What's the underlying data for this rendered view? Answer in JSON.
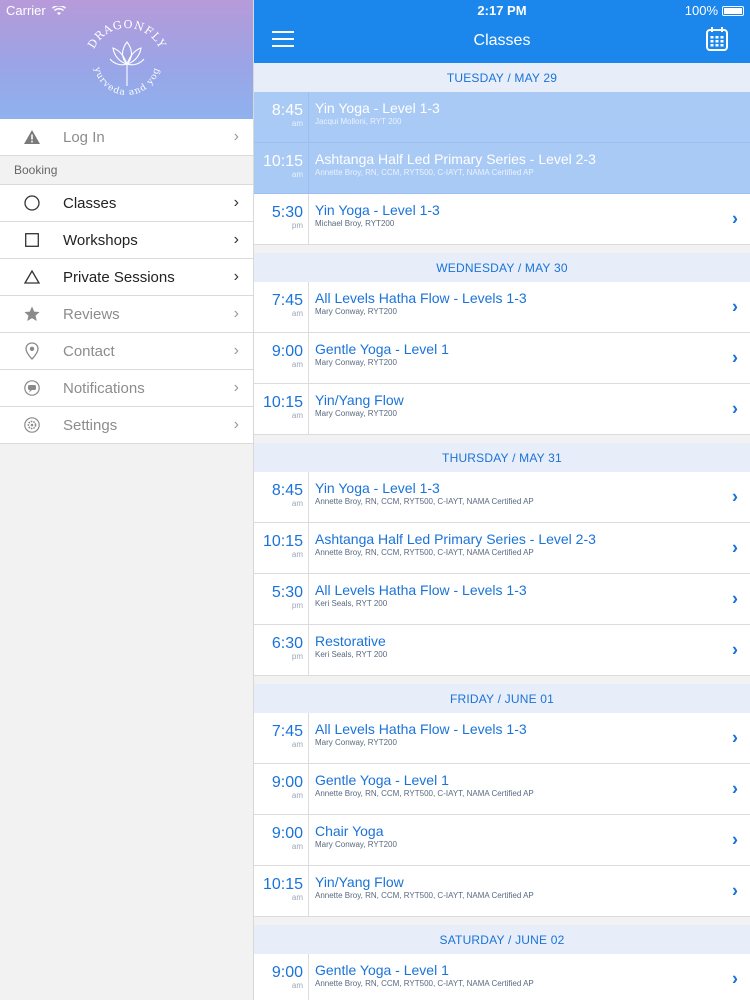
{
  "status": {
    "carrier": "Carrier",
    "time": "2:17 PM",
    "battery": "100%"
  },
  "sidebar": {
    "brand": "DRAGONFLY",
    "brand_tagline": "ayurveda and yoga",
    "login": {
      "label": "Log In",
      "icon": "warning-triangle-icon"
    },
    "section": "Booking",
    "items": [
      {
        "label": "Classes",
        "icon": "circle-icon"
      },
      {
        "label": "Workshops",
        "icon": "square-icon"
      },
      {
        "label": "Private Sessions",
        "icon": "triangle-icon"
      },
      {
        "label": "Reviews",
        "icon": "star-icon"
      },
      {
        "label": "Contact",
        "icon": "location-pin-icon"
      },
      {
        "label": "Notifications",
        "icon": "chat-bubble-icon"
      },
      {
        "label": "Settings",
        "icon": "gear-icon"
      }
    ]
  },
  "header": {
    "title": "Classes"
  },
  "colors": {
    "accent": "#1b86ec",
    "highlight": "#a9caf5",
    "day_header_bg": "#e7eef9"
  },
  "days": [
    {
      "header": "TUESDAY / MAY 29",
      "classes": [
        {
          "time": "8:45",
          "ampm": "am",
          "name": "Yin Yoga - Level 1-3",
          "instructor": "Jacqui Molloni, RYT 200",
          "highlight": true
        },
        {
          "time": "10:15",
          "ampm": "am",
          "name": "Ashtanga Half Led Primary Series - Level 2-3",
          "instructor": "Annette Broy, RN, CCM, RYT500, C-IAYT, NAMA Certified AP",
          "highlight": true
        },
        {
          "time": "5:30",
          "ampm": "pm",
          "name": "Yin Yoga - Level 1-3",
          "instructor": "Michael Broy, RYT200",
          "highlight": false
        }
      ]
    },
    {
      "header": "WEDNESDAY / MAY 30",
      "classes": [
        {
          "time": "7:45",
          "ampm": "am",
          "name": "All Levels Hatha Flow - Levels 1-3",
          "instructor": "Mary Conway, RYT200",
          "highlight": false
        },
        {
          "time": "9:00",
          "ampm": "am",
          "name": "Gentle Yoga - Level 1",
          "instructor": "Mary Conway, RYT200",
          "highlight": false
        },
        {
          "time": "10:15",
          "ampm": "am",
          "name": "Yin/Yang Flow",
          "instructor": "Mary Conway, RYT200",
          "highlight": false
        }
      ]
    },
    {
      "header": "THURSDAY / MAY 31",
      "classes": [
        {
          "time": "8:45",
          "ampm": "am",
          "name": "Yin Yoga - Level 1-3",
          "instructor": "Annette Broy, RN, CCM, RYT500, C-IAYT, NAMA Certified AP",
          "highlight": false
        },
        {
          "time": "10:15",
          "ampm": "am",
          "name": "Ashtanga Half Led Primary Series - Level 2-3",
          "instructor": "Annette Broy, RN, CCM, RYT500, C-IAYT, NAMA Certified AP",
          "highlight": false
        },
        {
          "time": "5:30",
          "ampm": "pm",
          "name": "All Levels Hatha Flow - Levels 1-3",
          "instructor": "Keri Seals, RYT 200",
          "highlight": false
        },
        {
          "time": "6:30",
          "ampm": "pm",
          "name": "Restorative",
          "instructor": "Keri Seals, RYT 200",
          "highlight": false
        }
      ]
    },
    {
      "header": "FRIDAY / JUNE 01",
      "classes": [
        {
          "time": "7:45",
          "ampm": "am",
          "name": "All Levels Hatha Flow - Levels 1-3",
          "instructor": "Mary Conway, RYT200",
          "highlight": false
        },
        {
          "time": "9:00",
          "ampm": "am",
          "name": "Gentle Yoga - Level 1",
          "instructor": "Annette Broy, RN, CCM, RYT500, C-IAYT, NAMA Certified AP",
          "highlight": false
        },
        {
          "time": "9:00",
          "ampm": "am",
          "name": "Chair Yoga",
          "instructor": "Mary Conway, RYT200",
          "highlight": false
        },
        {
          "time": "10:15",
          "ampm": "am",
          "name": "Yin/Yang Flow",
          "instructor": "Annette Broy, RN, CCM, RYT500, C-IAYT, NAMA Certified AP",
          "highlight": false
        }
      ]
    },
    {
      "header": "SATURDAY / JUNE 02",
      "classes": [
        {
          "time": "9:00",
          "ampm": "am",
          "name": "Gentle Yoga - Level 1",
          "instructor": "Annette Broy, RN, CCM, RYT500, C-IAYT, NAMA Certified AP",
          "highlight": false
        }
      ]
    }
  ]
}
